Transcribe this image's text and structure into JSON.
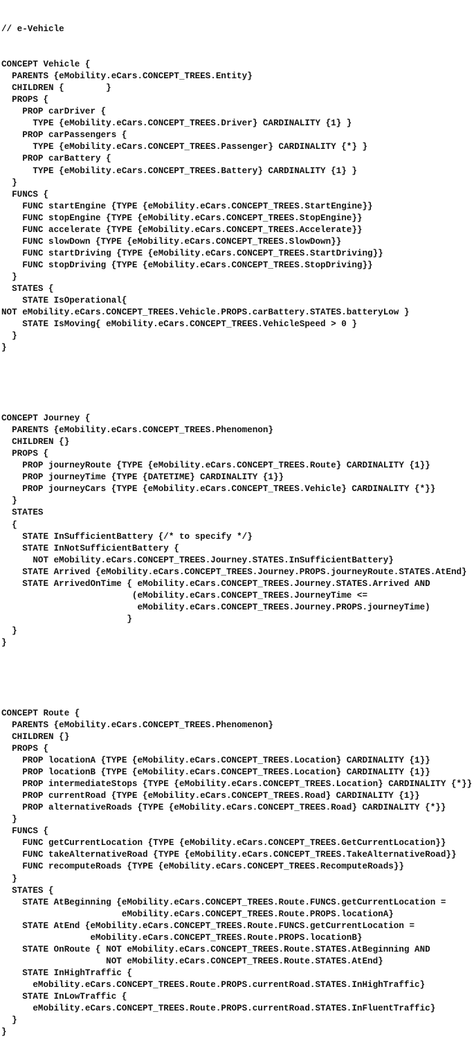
{
  "document": {
    "title_comment": "// e-Vehicle",
    "concepts": [
      {
        "name": "Vehicle",
        "lines": [
          "CONCEPT Vehicle {",
          "  PARENTS {eMobility.eCars.CONCEPT_TREES.Entity}",
          "  CHILDREN {        }",
          "  PROPS {",
          "    PROP carDriver {",
          "      TYPE {eMobility.eCars.CONCEPT_TREES.Driver} CARDINALITY {1} }",
          "    PROP carPassengers {",
          "      TYPE {eMobility.eCars.CONCEPT_TREES.Passenger} CARDINALITY {*} }",
          "    PROP carBattery {",
          "      TYPE {eMobility.eCars.CONCEPT_TREES.Battery} CARDINALITY {1} }",
          "  }",
          "  FUNCS {",
          "    FUNC startEngine {TYPE {eMobility.eCars.CONCEPT_TREES.StartEngine}}",
          "    FUNC stopEngine {TYPE {eMobility.eCars.CONCEPT_TREES.StopEngine}}",
          "    FUNC accelerate {TYPE {eMobility.eCars.CONCEPT_TREES.Accelerate}}",
          "    FUNC slowDown {TYPE {eMobility.eCars.CONCEPT_TREES.SlowDown}}",
          "    FUNC startDriving {TYPE {eMobility.eCars.CONCEPT_TREES.StartDriving}}",
          "    FUNC stopDriving {TYPE {eMobility.eCars.CONCEPT_TREES.StopDriving}}",
          "  }",
          "  STATES {",
          "    STATE IsOperational{",
          "NOT eMobility.eCars.CONCEPT_TREES.Vehicle.PROPS.carBattery.STATES.batteryLow }",
          "    STATE IsMoving{ eMobility.eCars.CONCEPT_TREES.VehicleSpeed > 0 }",
          "  }",
          "}"
        ]
      },
      {
        "name": "Journey",
        "lines": [
          "CONCEPT Journey {",
          "  PARENTS {eMobility.eCars.CONCEPT_TREES.Phenomenon}",
          "  CHILDREN {}",
          "  PROPS {",
          "    PROP journeyRoute {TYPE {eMobility.eCars.CONCEPT_TREES.Route} CARDINALITY {1}}",
          "    PROP journeyTime {TYPE {DATETIME} CARDINALITY {1}}",
          "    PROP journeyCars {TYPE {eMobility.eCars.CONCEPT_TREES.Vehicle} CARDINALITY {*}}",
          "  }",
          "  STATES",
          "  {",
          "    STATE InSufficientBattery {/* to specify */}",
          "    STATE InNotSufficientBattery {",
          "      NOT eMobility.eCars.CONCEPT_TREES.Journey.STATES.InSufficientBattery}",
          "    STATE Arrived {eMobility.eCars.CONCEPT_TREES.Journey.PROPS.journeyRoute.STATES.AtEnd}",
          "    STATE ArrivedOnTime { eMobility.eCars.CONCEPT_TREES.Journey.STATES.Arrived AND",
          "                         (eMobility.eCars.CONCEPT_TREES.JourneyTime <=",
          "                          eMobility.eCars.CONCEPT_TREES.Journey.PROPS.journeyTime)",
          "                        }",
          "  }",
          "}"
        ]
      },
      {
        "name": "Route",
        "lines": [
          "CONCEPT Route {",
          "  PARENTS {eMobility.eCars.CONCEPT_TREES.Phenomenon}",
          "  CHILDREN {}",
          "  PROPS {",
          "    PROP locationA {TYPE {eMobility.eCars.CONCEPT_TREES.Location} CARDINALITY {1}}",
          "    PROP locationB {TYPE {eMobility.eCars.CONCEPT_TREES.Location} CARDINALITY {1}}",
          "    PROP intermediateStops {TYPE {eMobility.eCars.CONCEPT_TREES.Location} CARDINALITY {*}}",
          "    PROP currentRoad {TYPE {eMobility.eCars.CONCEPT_TREES.Road} CARDINALITY {1}}",
          "    PROP alternativeRoads {TYPE {eMobility.eCars.CONCEPT_TREES.Road} CARDINALITY {*}}",
          "  }",
          "  FUNCS {",
          "    FUNC getCurrentLocation {TYPE {eMobility.eCars.CONCEPT_TREES.GetCurrentLocation}}",
          "    FUNC takeAlternativeRoad {TYPE {eMobility.eCars.CONCEPT_TREES.TakeAlternativeRoad}}",
          "    FUNC recomputeRoads {TYPE {eMobility.eCars.CONCEPT_TREES.RecomputeRoads}}",
          "  }",
          "  STATES {",
          "    STATE AtBeginning {eMobility.eCars.CONCEPT_TREES.Route.FUNCS.getCurrentLocation =",
          "                       eMobility.eCars.CONCEPT_TREES.Route.PROPS.locationA}",
          "    STATE AtEnd {eMobility.eCars.CONCEPT_TREES.Route.FUNCS.getCurrentLocation =",
          "                 eMobility.eCars.CONCEPT_TREES.Route.PROPS.locationB}",
          "    STATE OnRoute { NOT eMobility.eCars.CONCEPT_TREES.Route.STATES.AtBeginning AND",
          "                    NOT eMobility.eCars.CONCEPT_TREES.Route.STATES.AtEnd}",
          "    STATE InHighTraffic {",
          "      eMobility.eCars.CONCEPT_TREES.Route.PROPS.currentRoad.STATES.InHighTraffic}",
          "    STATE InLowTraffic {",
          "      eMobility.eCars.CONCEPT_TREES.Route.PROPS.currentRoad.STATES.InFluentTraffic}",
          "  }",
          "}"
        ]
      }
    ]
  }
}
